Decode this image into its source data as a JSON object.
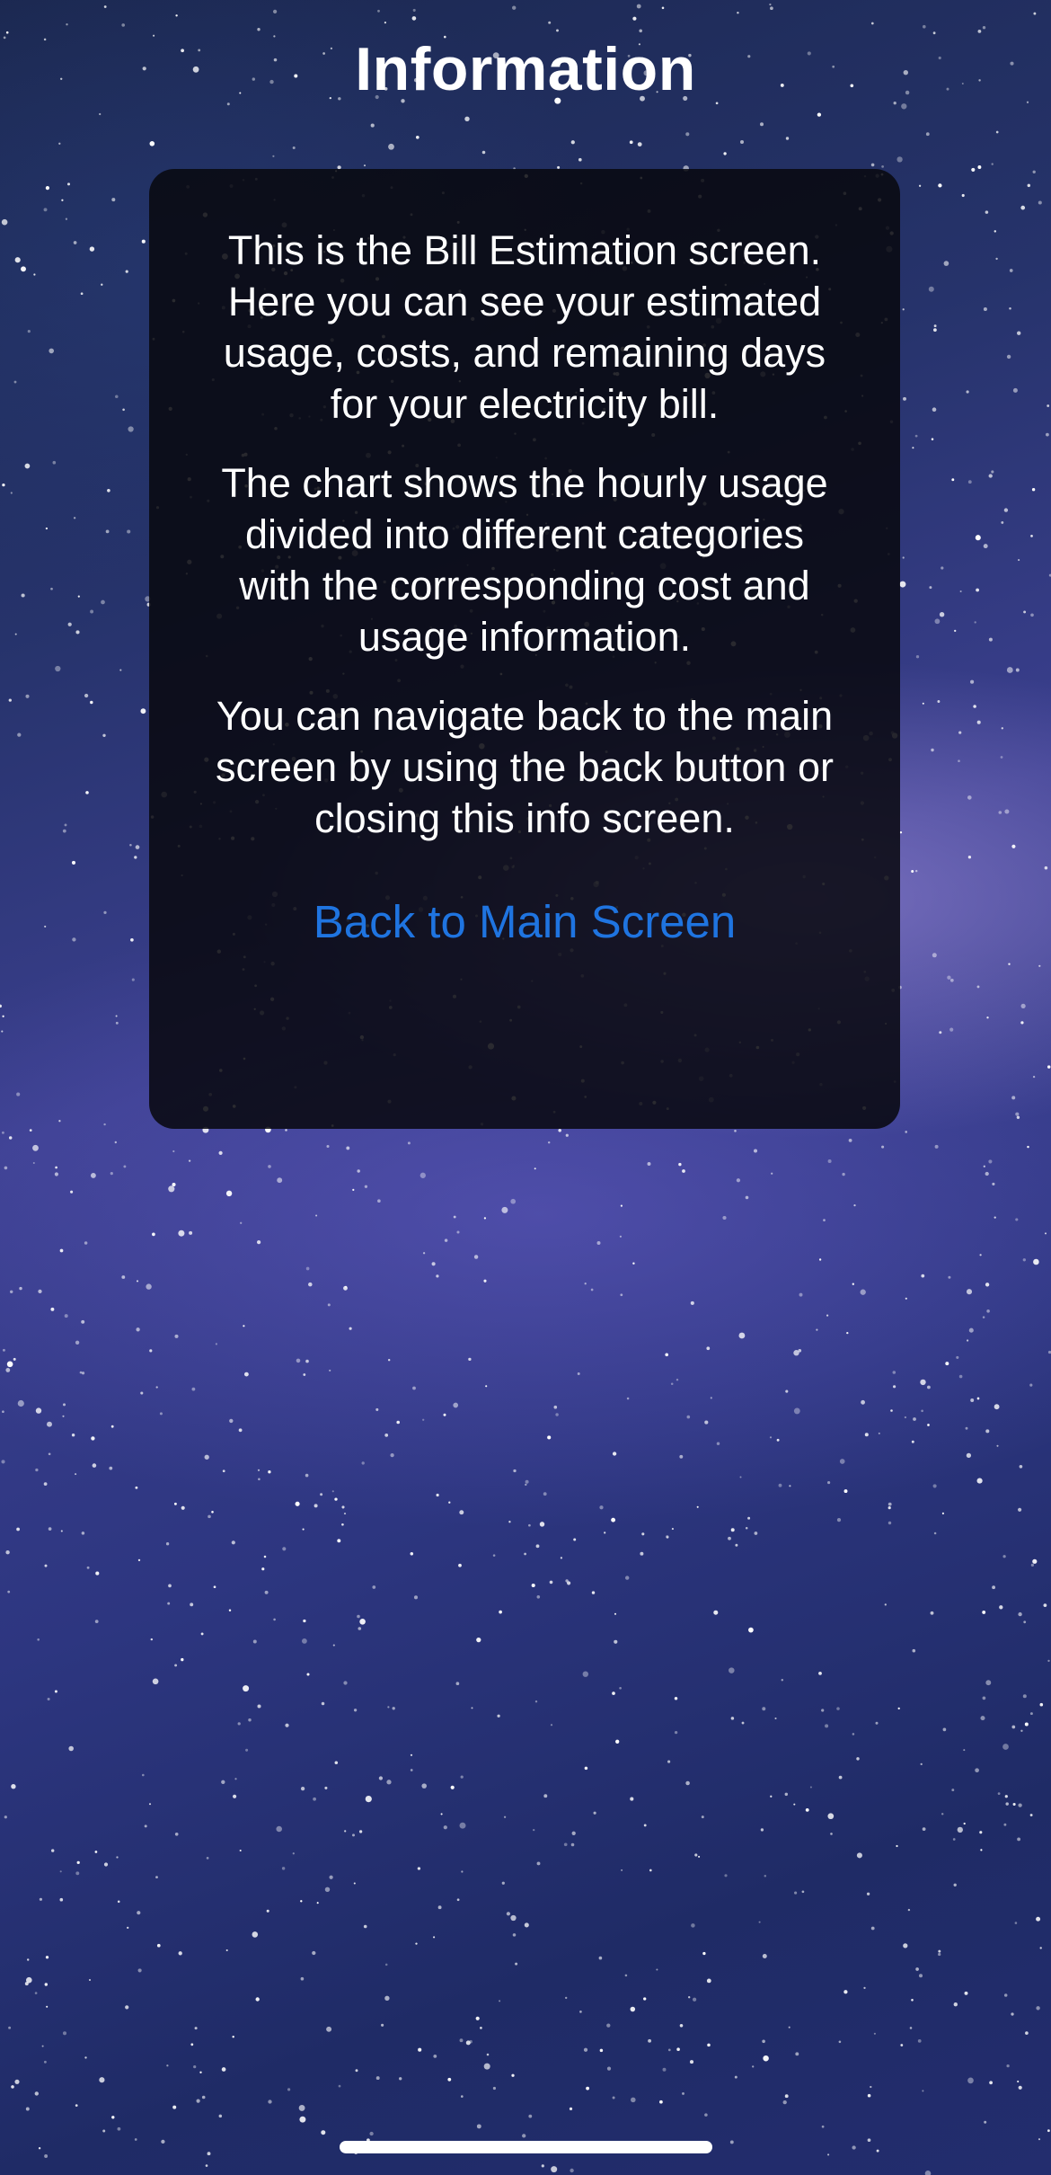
{
  "screen": {
    "title": "Information"
  },
  "info_card": {
    "paragraphs": [
      "This is the Bill Estimation screen. Here you can see your estimated usage, costs, and remaining days for your electricity bill.",
      "The chart shows the hourly usage divided into different categories with the corresponding cost and usage information.",
      "You can navigate back to the main screen by using the back button or closing this info screen."
    ],
    "back_link_label": "Back to Main Screen"
  },
  "colors": {
    "link": "#1f74e0",
    "card_background": "#08080e",
    "text": "#ffffff"
  }
}
